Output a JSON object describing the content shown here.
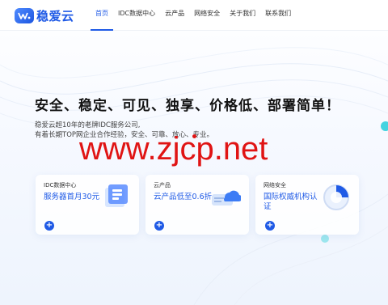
{
  "header": {
    "logo_text": "稳爱云",
    "nav": [
      {
        "label": "首页"
      },
      {
        "label": "IDC数据中心"
      },
      {
        "label": "云产品"
      },
      {
        "label": "网络安全"
      },
      {
        "label": "关于我们"
      },
      {
        "label": "联系我们"
      }
    ],
    "active_index": 0
  },
  "hero": {
    "title": "安全、稳定、可见、独享、价格低、部署简单！",
    "desc_line1": "稳爱云超10年的老牌IDC服务公司,",
    "desc_line2": "有着长期TOP网企业合作经验，安全、可靠、放心、专业。"
  },
  "watermark": "www.zjcp.net",
  "cards": [
    {
      "sub": "IDC数据中心",
      "main": "服务器首月30元",
      "icon": "server-cube-icon"
    },
    {
      "sub": "云产品",
      "main": "云产品低至0.6折",
      "icon": "cloud-server-icon"
    },
    {
      "sub": "网络安全",
      "main": "国际权威机构认证",
      "icon": "security-dial-icon"
    }
  ],
  "colors": {
    "brand": "#1f5ae6",
    "watermark": "#e01414",
    "accent_cyan": "#44d3e0"
  }
}
